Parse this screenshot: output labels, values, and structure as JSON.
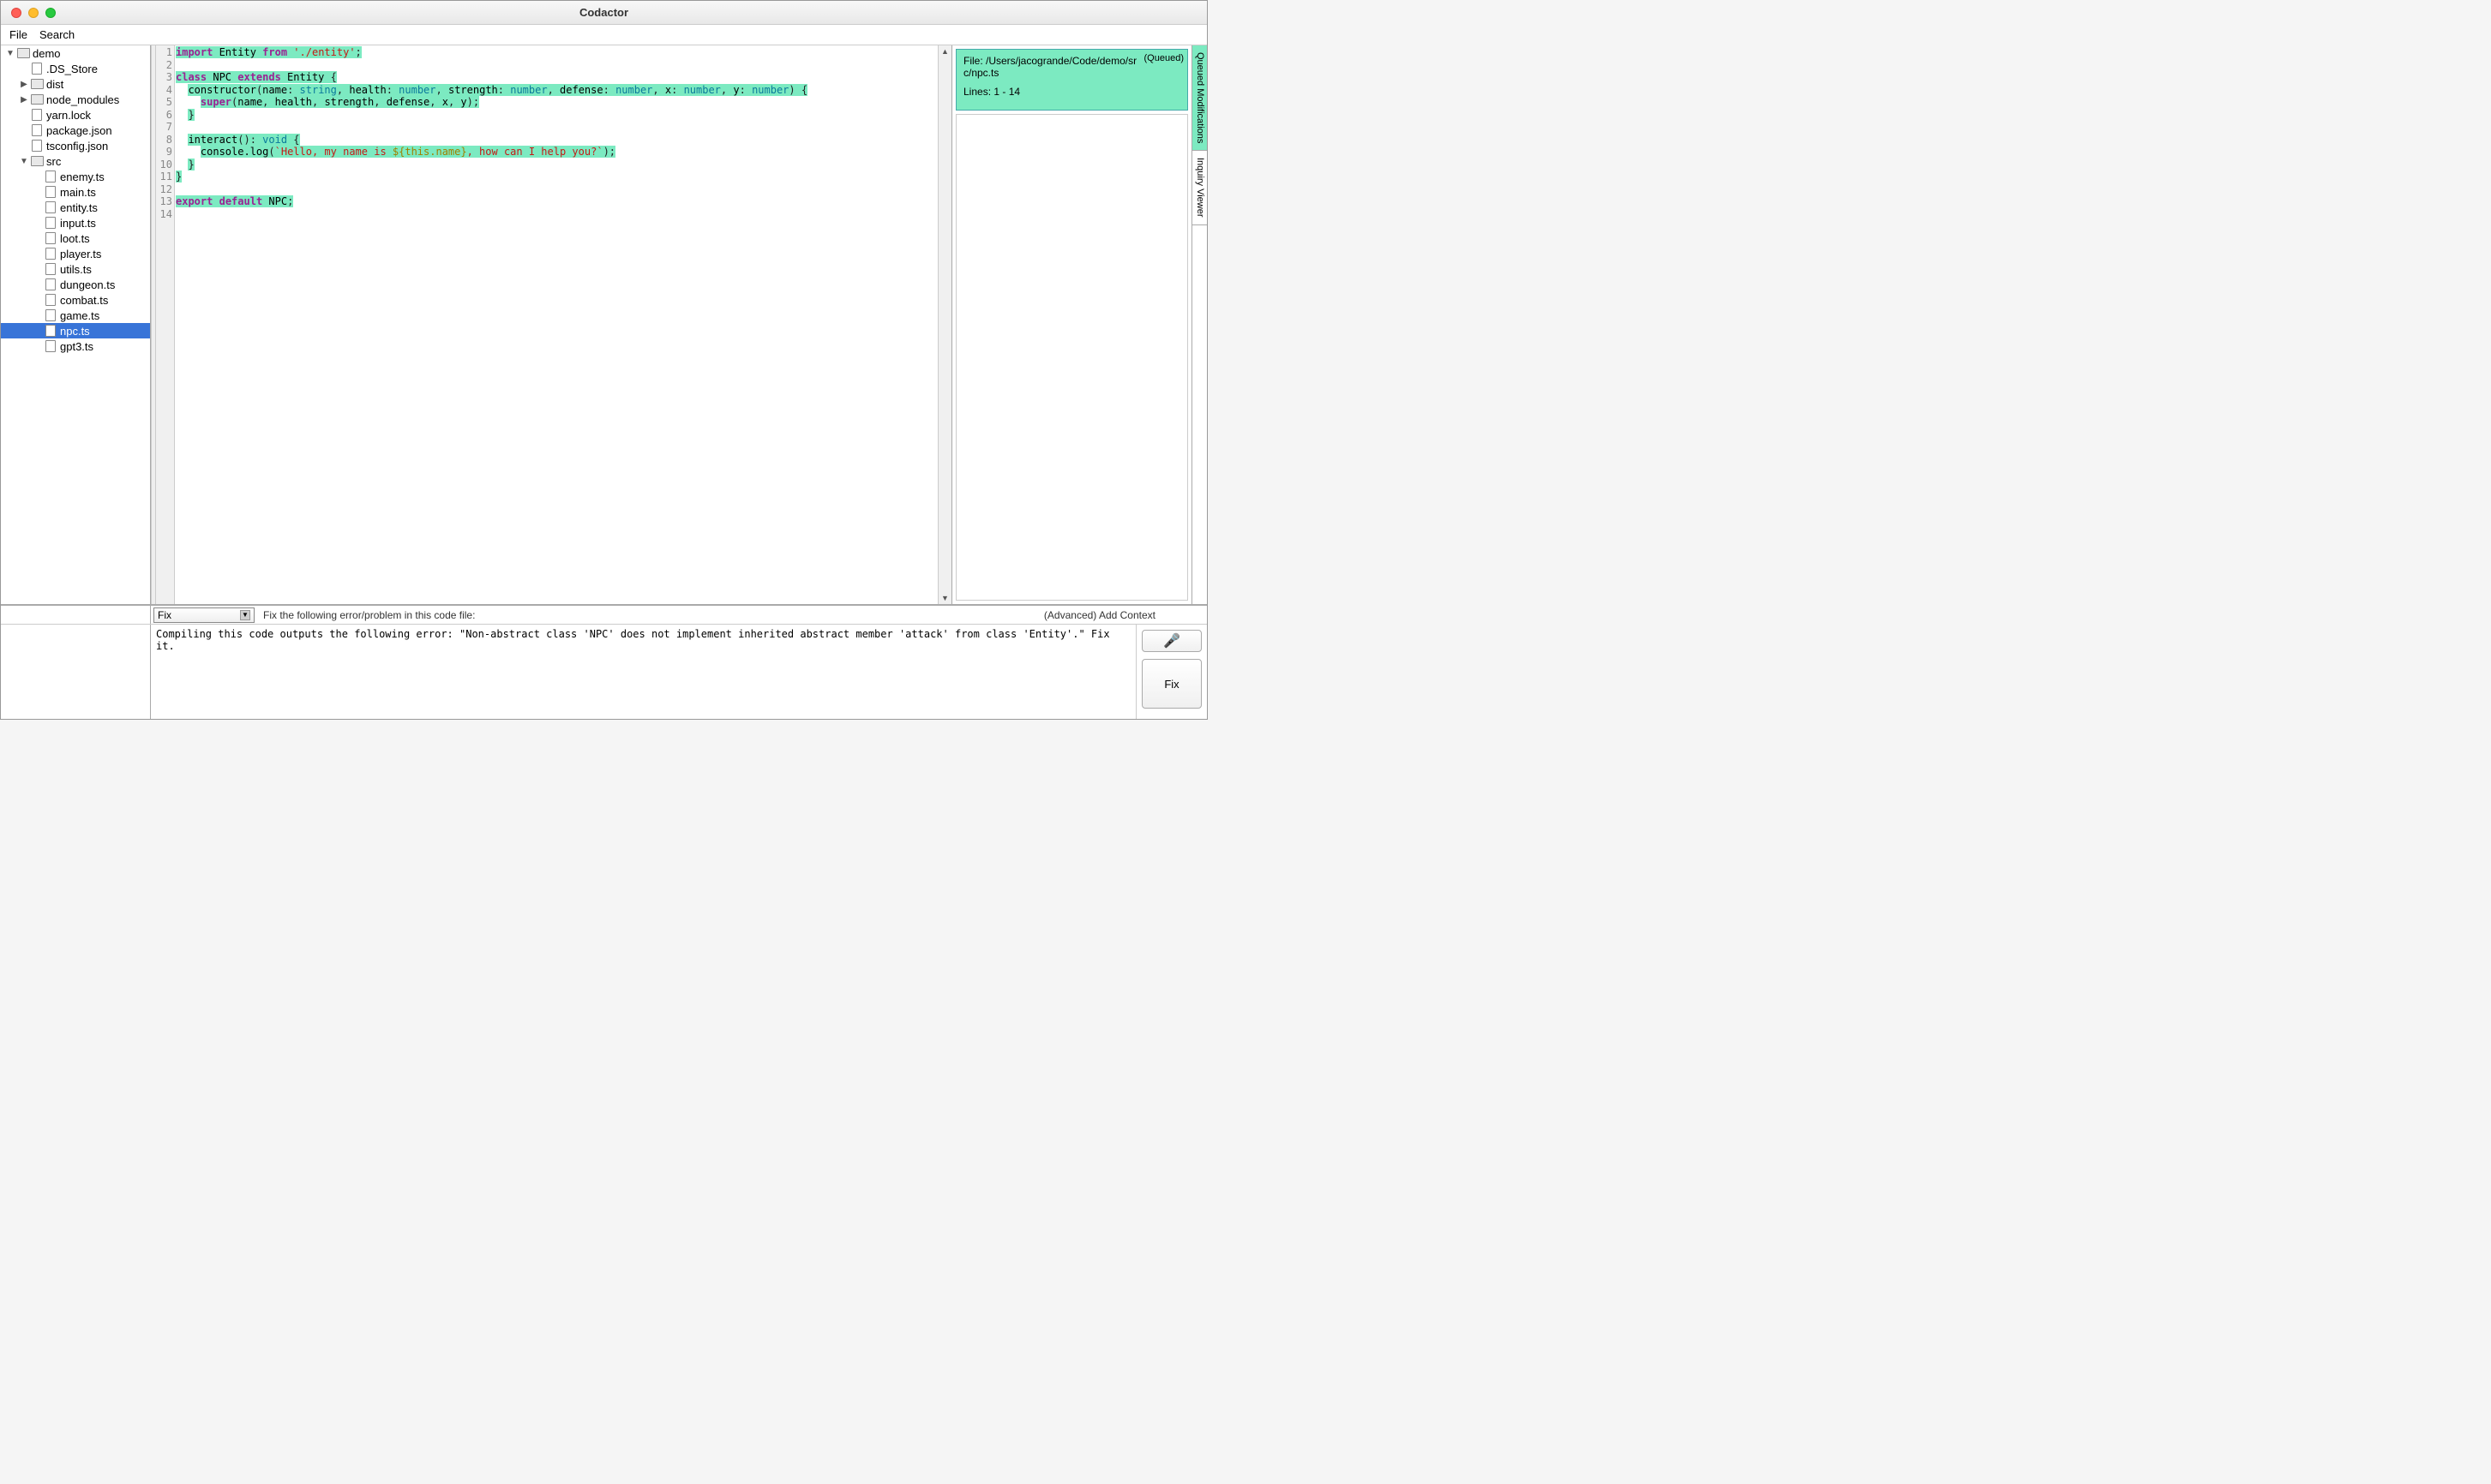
{
  "window": {
    "title": "Codactor"
  },
  "menubar": [
    "File",
    "Search"
  ],
  "tree": [
    {
      "d": 0,
      "t": "folder",
      "open": true,
      "name": "demo"
    },
    {
      "d": 1,
      "t": "file",
      "name": ".DS_Store"
    },
    {
      "d": 1,
      "t": "folder",
      "open": false,
      "name": "dist"
    },
    {
      "d": 1,
      "t": "folder",
      "open": false,
      "name": "node_modules"
    },
    {
      "d": 1,
      "t": "file",
      "name": "yarn.lock"
    },
    {
      "d": 1,
      "t": "file",
      "name": "package.json"
    },
    {
      "d": 1,
      "t": "file",
      "name": "tsconfig.json"
    },
    {
      "d": 1,
      "t": "folder",
      "open": true,
      "name": "src"
    },
    {
      "d": 2,
      "t": "file",
      "name": "enemy.ts"
    },
    {
      "d": 2,
      "t": "file",
      "name": "main.ts"
    },
    {
      "d": 2,
      "t": "file",
      "name": "entity.ts"
    },
    {
      "d": 2,
      "t": "file",
      "name": "input.ts"
    },
    {
      "d": 2,
      "t": "file",
      "name": "loot.ts"
    },
    {
      "d": 2,
      "t": "file",
      "name": "player.ts"
    },
    {
      "d": 2,
      "t": "file",
      "name": "utils.ts"
    },
    {
      "d": 2,
      "t": "file",
      "name": "dungeon.ts"
    },
    {
      "d": 2,
      "t": "file",
      "name": "combat.ts"
    },
    {
      "d": 2,
      "t": "file",
      "name": "game.ts"
    },
    {
      "d": 2,
      "t": "file",
      "name": "npc.ts",
      "selected": true
    },
    {
      "d": 2,
      "t": "file",
      "name": "gpt3.ts"
    }
  ],
  "editor": {
    "line_count": 14,
    "lines": [
      [
        {
          "c": "hl",
          "s": [
            [
              "kw",
              "import"
            ],
            [
              "",
              " Entity "
            ],
            [
              "kw",
              "from"
            ],
            [
              "",
              " "
            ],
            [
              "str",
              "'./entity'"
            ],
            [
              "punct",
              ";"
            ]
          ]
        }
      ],
      [],
      [
        {
          "c": "hl",
          "s": [
            [
              "kw",
              "class"
            ],
            [
              "",
              " NPC "
            ],
            [
              "kw",
              "extends"
            ],
            [
              "",
              " Entity "
            ],
            [
              "punct",
              "{"
            ]
          ]
        }
      ],
      [
        {
          "c": "",
          "s": [
            [
              "",
              "  "
            ]
          ]
        },
        {
          "c": "hl",
          "s": [
            [
              "",
              "constructor"
            ],
            [
              "punct",
              "("
            ],
            [
              "",
              "name"
            ],
            [
              "punct",
              ": "
            ],
            [
              "type",
              "string"
            ],
            [
              "punct",
              ", "
            ],
            [
              "",
              "health"
            ],
            [
              "punct",
              ": "
            ],
            [
              "type",
              "number"
            ],
            [
              "punct",
              ", "
            ],
            [
              "",
              "strength"
            ],
            [
              "punct",
              ": "
            ],
            [
              "type",
              "number"
            ],
            [
              "punct",
              ", "
            ],
            [
              "",
              "defense"
            ],
            [
              "punct",
              ": "
            ],
            [
              "type",
              "number"
            ],
            [
              "punct",
              ", "
            ],
            [
              "",
              "x"
            ],
            [
              "punct",
              ": "
            ],
            [
              "type",
              "number"
            ],
            [
              "punct",
              ", "
            ],
            [
              "",
              "y"
            ],
            [
              "punct",
              ": "
            ],
            [
              "type",
              "number"
            ],
            [
              "punct",
              ") {"
            ]
          ]
        }
      ],
      [
        {
          "c": "",
          "s": [
            [
              "",
              "    "
            ]
          ]
        },
        {
          "c": "hl",
          "s": [
            [
              "kw",
              "super"
            ],
            [
              "punct",
              "("
            ],
            [
              "",
              "name"
            ],
            [
              "punct",
              ", "
            ],
            [
              "",
              "health"
            ],
            [
              "punct",
              ", "
            ],
            [
              "",
              "strength"
            ],
            [
              "punct",
              ", "
            ],
            [
              "",
              "defense"
            ],
            [
              "punct",
              ", "
            ],
            [
              "",
              "x"
            ],
            [
              "punct",
              ", "
            ],
            [
              "",
              "y"
            ],
            [
              "punct",
              ");"
            ]
          ]
        }
      ],
      [
        {
          "c": "",
          "s": [
            [
              "",
              "  "
            ]
          ]
        },
        {
          "c": "hl",
          "s": [
            [
              "punct",
              "}"
            ]
          ]
        }
      ],
      [],
      [
        {
          "c": "",
          "s": [
            [
              "",
              "  "
            ]
          ]
        },
        {
          "c": "hl",
          "s": [
            [
              "",
              "interact"
            ],
            [
              "punct",
              "(): "
            ],
            [
              "type",
              "void"
            ],
            [
              "punct",
              " {"
            ]
          ]
        }
      ],
      [
        {
          "c": "",
          "s": [
            [
              "",
              "    "
            ]
          ]
        },
        {
          "c": "hl",
          "s": [
            [
              "",
              "console.log"
            ],
            [
              "punct",
              "("
            ],
            [
              "tmpl",
              "`Hello, my name is "
            ],
            [
              "tmplvar",
              "${this.name}"
            ],
            [
              "tmpl",
              ", how can I help you?`"
            ],
            [
              "punct",
              ");"
            ]
          ]
        }
      ],
      [
        {
          "c": "",
          "s": [
            [
              "",
              "  "
            ]
          ]
        },
        {
          "c": "hl",
          "s": [
            [
              "punct",
              "}"
            ]
          ]
        }
      ],
      [
        {
          "c": "hl",
          "s": [
            [
              "punct",
              "}"
            ]
          ]
        }
      ],
      [],
      [
        {
          "c": "hl",
          "s": [
            [
              "kw",
              "export"
            ],
            [
              "",
              " "
            ],
            [
              "kw",
              "default"
            ],
            [
              "",
              " NPC"
            ],
            [
              "punct",
              ";"
            ]
          ]
        }
      ],
      []
    ]
  },
  "queued": {
    "tab_label": "Queued Modifications",
    "queued_badge": "(Queued)",
    "file_label": "File: /Users/jacogrande/Code/demo/src/npc.ts",
    "lines_label": "Lines: 1 - 14"
  },
  "inquiry_tab_label": "Inquiry Viewer",
  "command": {
    "dropdown_value": "Fix",
    "hint": "Fix the following error/problem in this code file:",
    "context_link": "(Advanced) Add Context"
  },
  "prompt": "Compiling this code outputs the following error: \"Non-abstract class 'NPC' does not implement inherited abstract member 'attack' from class 'Entity'.\" Fix it.",
  "buttons": {
    "fix": "Fix"
  }
}
